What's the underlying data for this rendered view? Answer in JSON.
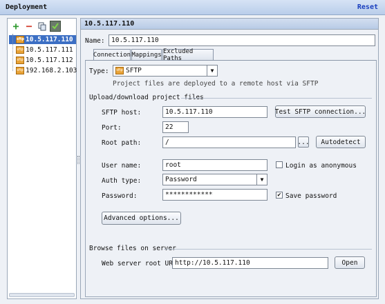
{
  "window": {
    "title": "Deployment",
    "reset_label": "Reset"
  },
  "toolbar": {
    "add_icon": "plus-icon",
    "remove_icon": "minus-icon",
    "copy_icon": "copy-icon",
    "default_icon": "set-default-icon"
  },
  "servers": [
    {
      "label": "10.5.117.110",
      "selected": true
    },
    {
      "label": "10.5.117.111"
    },
    {
      "label": "10.5.117.112"
    },
    {
      "label": "192.168.2.103"
    }
  ],
  "server_icon_text": "sftp",
  "header": {
    "title": "10.5.117.110"
  },
  "name": {
    "label": "Name:",
    "value": "10.5.117.110"
  },
  "tabs": [
    {
      "label": "Connection",
      "active": true
    },
    {
      "label": "Mappings"
    },
    {
      "label": "Excluded Paths"
    }
  ],
  "connection": {
    "type_label": "Type:",
    "type_value": "SFTP",
    "type_hint": "Project files are deployed to a remote host via SFTP",
    "section_upload": "Upload/download project files",
    "host_label": "SFTP host:",
    "host_value": "10.5.117.110",
    "test_button": "Test SFTP connection...",
    "port_label": "Port:",
    "port_value": "22",
    "root_label": "Root path:",
    "root_value": "/",
    "browse_button": "...",
    "autodetect_button": "Autodetect",
    "user_label": "User name:",
    "user_value": "root",
    "anon_label": "Login as anonymous",
    "auth_label": "Auth type:",
    "auth_value": "Password",
    "password_label": "Password:",
    "password_value": "************",
    "save_password_label": "Save password",
    "save_password_checked": "✔",
    "advanced_button": "Advanced options...",
    "section_browse": "Browse files on server",
    "web_root_label": "Web server root URL:",
    "web_root_value": "http://10.5.117.110",
    "open_button": "Open"
  }
}
